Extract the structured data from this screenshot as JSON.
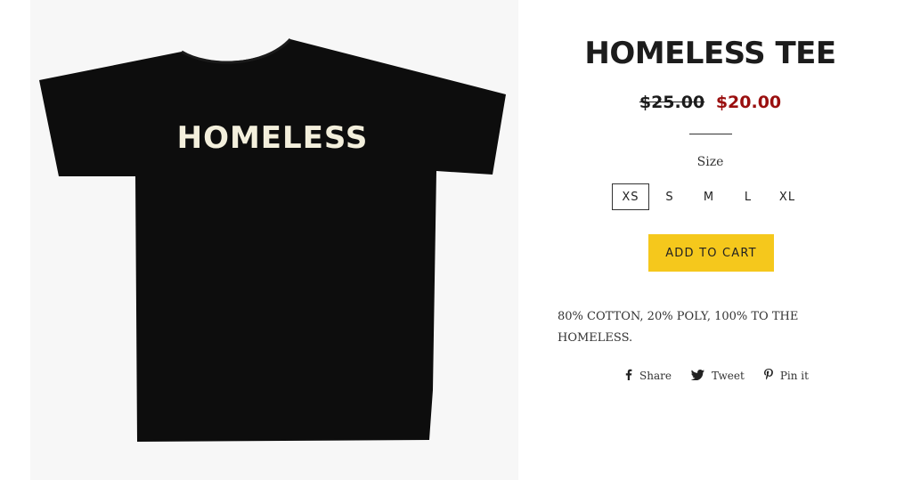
{
  "product": {
    "title": "HOMELESS TEE",
    "price_original": "$25.00",
    "price_sale": "$20.00",
    "image_text": "HOMELESS",
    "size_label": "Size",
    "sizes": [
      "XS",
      "S",
      "M",
      "L",
      "XL"
    ],
    "selected_size": "XS",
    "add_to_cart_label": "ADD TO CART",
    "description": "80% COTTON, 20% POLY, 100% TO THE HOMELESS."
  },
  "share": {
    "items": [
      {
        "label": "Share",
        "icon": "facebook-icon"
      },
      {
        "label": "Tweet",
        "icon": "twitter-icon"
      },
      {
        "label": "Pin it",
        "icon": "pinterest-icon"
      }
    ]
  },
  "colors": {
    "sale_price": "#9a0f0f",
    "button_bg": "#f5c81c",
    "shirt": "#0d0d0d",
    "shirt_print": "#f3efdc"
  }
}
